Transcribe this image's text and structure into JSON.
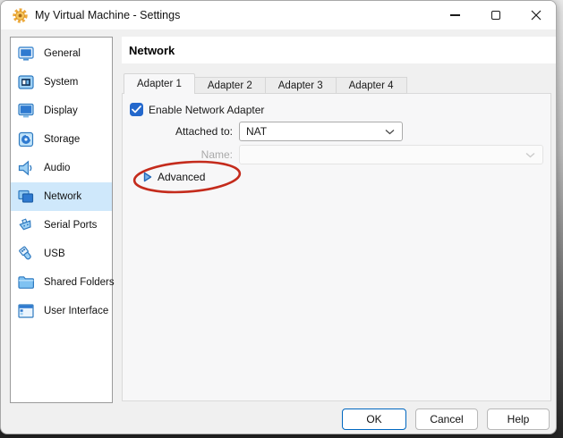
{
  "window": {
    "title": "My Virtual Machine - Settings",
    "app_icon": "gear-icon",
    "controls": {
      "minimize": "minimize-icon",
      "maximize": "maximize-icon",
      "close": "close-icon"
    }
  },
  "sidebar": {
    "selected": "Network",
    "items": [
      {
        "label": "General",
        "icon": "general-icon"
      },
      {
        "label": "System",
        "icon": "system-icon"
      },
      {
        "label": "Display",
        "icon": "display-icon"
      },
      {
        "label": "Storage",
        "icon": "storage-icon"
      },
      {
        "label": "Audio",
        "icon": "audio-icon"
      },
      {
        "label": "Network",
        "icon": "network-icon"
      },
      {
        "label": "Serial Ports",
        "icon": "serial-ports-icon"
      },
      {
        "label": "USB",
        "icon": "usb-icon"
      },
      {
        "label": "Shared Folders",
        "icon": "shared-folders-icon"
      },
      {
        "label": "User Interface",
        "icon": "user-interface-icon"
      }
    ]
  },
  "page": {
    "title": "Network"
  },
  "tabs": [
    {
      "label": "Adapter 1",
      "selected": true
    },
    {
      "label": "Adapter 2",
      "selected": false
    },
    {
      "label": "Adapter 3",
      "selected": false
    },
    {
      "label": "Adapter 4",
      "selected": false
    }
  ],
  "form": {
    "enable_adapter": {
      "label": "Enable Network Adapter",
      "checked": true
    },
    "attached_to": {
      "label": "Attached to:",
      "value": "NAT"
    },
    "name": {
      "label": "Name:",
      "value": "",
      "disabled": true
    },
    "advanced": {
      "label": "Advanced",
      "expanded": false
    }
  },
  "annotation": {
    "type": "ellipse",
    "color": "#c42b1c",
    "around": "Advanced"
  },
  "footer": {
    "buttons": [
      {
        "label": "OK",
        "default": true
      },
      {
        "label": "Cancel",
        "default": false
      },
      {
        "label": "Help",
        "default": false
      }
    ]
  },
  "colors": {
    "accent_blue": "#2468cc",
    "selected_item_bg": "#cfe8fb",
    "annotation_red": "#c42b1c"
  }
}
